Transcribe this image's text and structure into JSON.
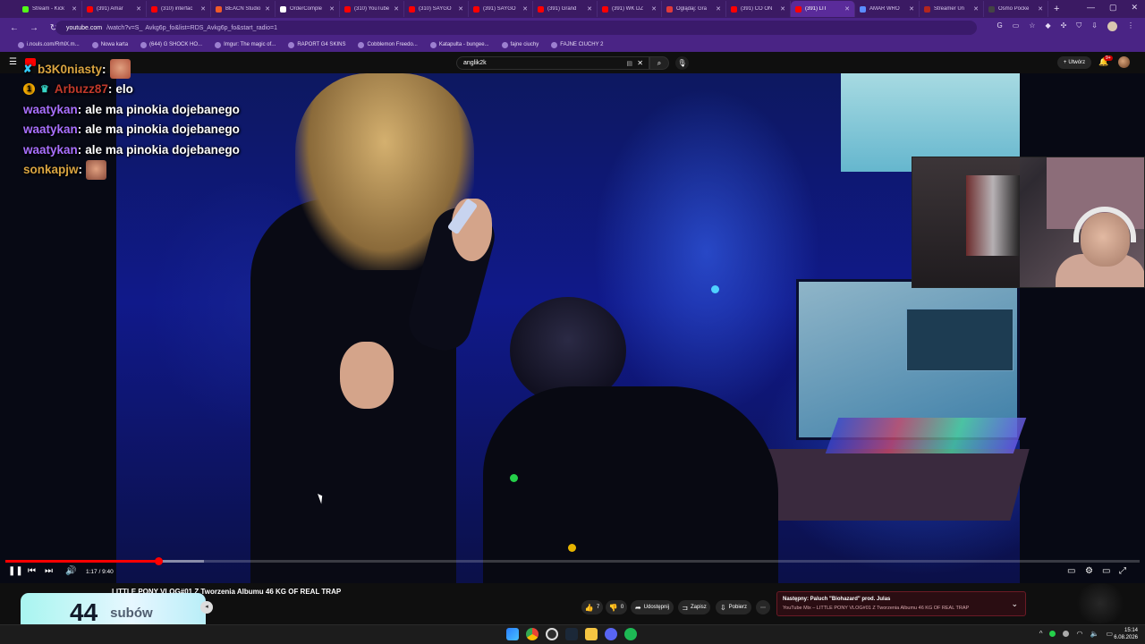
{
  "browser": {
    "tabs": [
      {
        "label": "Stream - Kick",
        "color": "#53fc18",
        "active": false
      },
      {
        "label": "(391) Amar",
        "color": "#ff0000",
        "active": false
      },
      {
        "label": "(310) interfac",
        "color": "#ff0000",
        "active": false
      },
      {
        "label": "BEACN Studio",
        "color": "#f05a28",
        "active": false
      },
      {
        "label": "OrderComple",
        "color": "#ffffff",
        "active": false
      },
      {
        "label": "(310) YouTube",
        "color": "#ff0000",
        "active": false
      },
      {
        "label": "(310) SAYGO",
        "color": "#ff0000",
        "active": false
      },
      {
        "label": "(391) SAYGO",
        "color": "#ff0000",
        "active": false
      },
      {
        "label": "(391) Grand",
        "color": "#ff0000",
        "active": false
      },
      {
        "label": "(391) WK DZ",
        "color": "#ff0000",
        "active": false
      },
      {
        "label": "Oglądaj: Gra",
        "color": "#e03a3a",
        "active": false
      },
      {
        "label": "(391) CO ON",
        "color": "#ff0000",
        "active": false
      },
      {
        "label": "(391) LIT",
        "color": "#ff0000",
        "active": true
      },
      {
        "label": "AMAR WRO",
        "color": "#5b8cff",
        "active": false
      },
      {
        "label": "Streamer Un",
        "color": "#b3261e",
        "active": false
      },
      {
        "label": "Osmo Pocke",
        "color": "#444444",
        "active": false
      }
    ],
    "url_host": "youtube.com",
    "url_rest": "Avkg6p_fo&list=RDS_Avkg6p_fo&start_radio=1",
    "bookmarks": [
      "i.nouls.com/RrhlX.m...",
      "Nowa karta",
      "(644) G SHOCK HO...",
      "Imgur: The magic of...",
      "RAPORT G4 SKINS",
      "Cobblemon Freedo...",
      "Katapulta - bungee...",
      "fajne ciuchy",
      "FAJNE CIUCHY 2"
    ]
  },
  "youtube": {
    "logo_text": "YouTube",
    "search_value": "anglik2k",
    "create_label": "Utwórz",
    "bell_badge": "9+",
    "accent": "#ff0000"
  },
  "chat": [
    {
      "badge": "kick",
      "user": "b3K0niasty",
      "color": "#d9a441",
      "msg": "",
      "emote": "#b0503a"
    },
    {
      "badge": "round",
      "badge2": "crown",
      "user": "Arbuzz87",
      "color": "#c0392b",
      "msg": "elo",
      "emote": ""
    },
    {
      "badge": "",
      "user": "waatykan",
      "color": "#a970ff",
      "msg": "ale ma pinokia dojebanego",
      "emote": ""
    },
    {
      "badge": "",
      "user": "waatykan",
      "color": "#a970ff",
      "msg": "ale ma pinokia dojebanego",
      "emote": ""
    },
    {
      "badge": "",
      "user": "waatykan",
      "color": "#a970ff",
      "msg": "ale ma pinokia dojebanego",
      "emote": ""
    },
    {
      "badge": "",
      "user": "sonkapjw",
      "color": "#d9a441",
      "msg": "",
      "emote": "#8a4a3a"
    }
  ],
  "player": {
    "time_current": "1:17",
    "time_total": "9:40",
    "played_fraction": 0.1345,
    "buffered_fraction": 0.175
  },
  "video": {
    "title": "LITTLE PONY VLOG#01 Z Tworzenia Albumu 46 KG OF REAL TRAP",
    "likes": "7",
    "dislikes": "0",
    "share_label": "Udostępnij",
    "save_label": "Zapisz",
    "download_label": "Pobierz"
  },
  "next_up": {
    "title": "Następny: Paluch \"Biohazard\" prod. Julas",
    "subtitle": "YouTube Mix – LITTLE PONY VLOG#01 Z Tworzenia Albumu 46 KG OF REAL TRAP"
  },
  "sub_widget": {
    "count": "44",
    "label": "subów"
  },
  "taskbar": {
    "time": "15:14",
    "date": "6.08.2026",
    "pinned": [
      "windows-start",
      "chrome",
      "obs",
      "steam",
      "file-explorer",
      "discord",
      "spotify"
    ]
  }
}
